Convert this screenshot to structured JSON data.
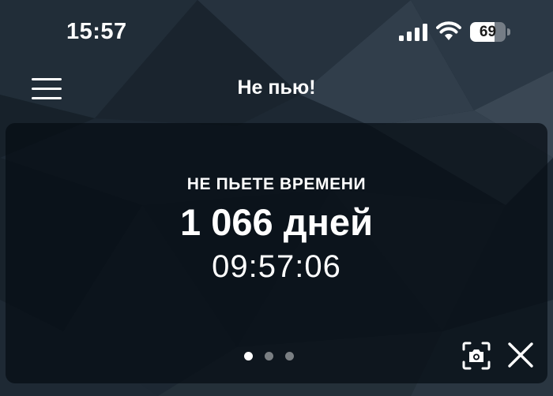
{
  "status_bar": {
    "time": "15:57",
    "battery_level": "69",
    "battery_fraction": 0.69,
    "icons": [
      "cellular-signal-icon",
      "wifi-icon",
      "battery-icon"
    ]
  },
  "nav": {
    "menu_icon": "hamburger-menu-icon",
    "title": "Не пью!"
  },
  "card": {
    "label": "НЕ ПЬЕТЕ ВРЕМЕНИ",
    "days": "1 066 дней",
    "time": "09:57:06",
    "page_count": 3,
    "active_page": 0,
    "actions": [
      "camera-icon",
      "close-icon"
    ]
  },
  "colors": {
    "background": "#1c2630",
    "card_background": "#060c14",
    "text": "#ffffff"
  }
}
